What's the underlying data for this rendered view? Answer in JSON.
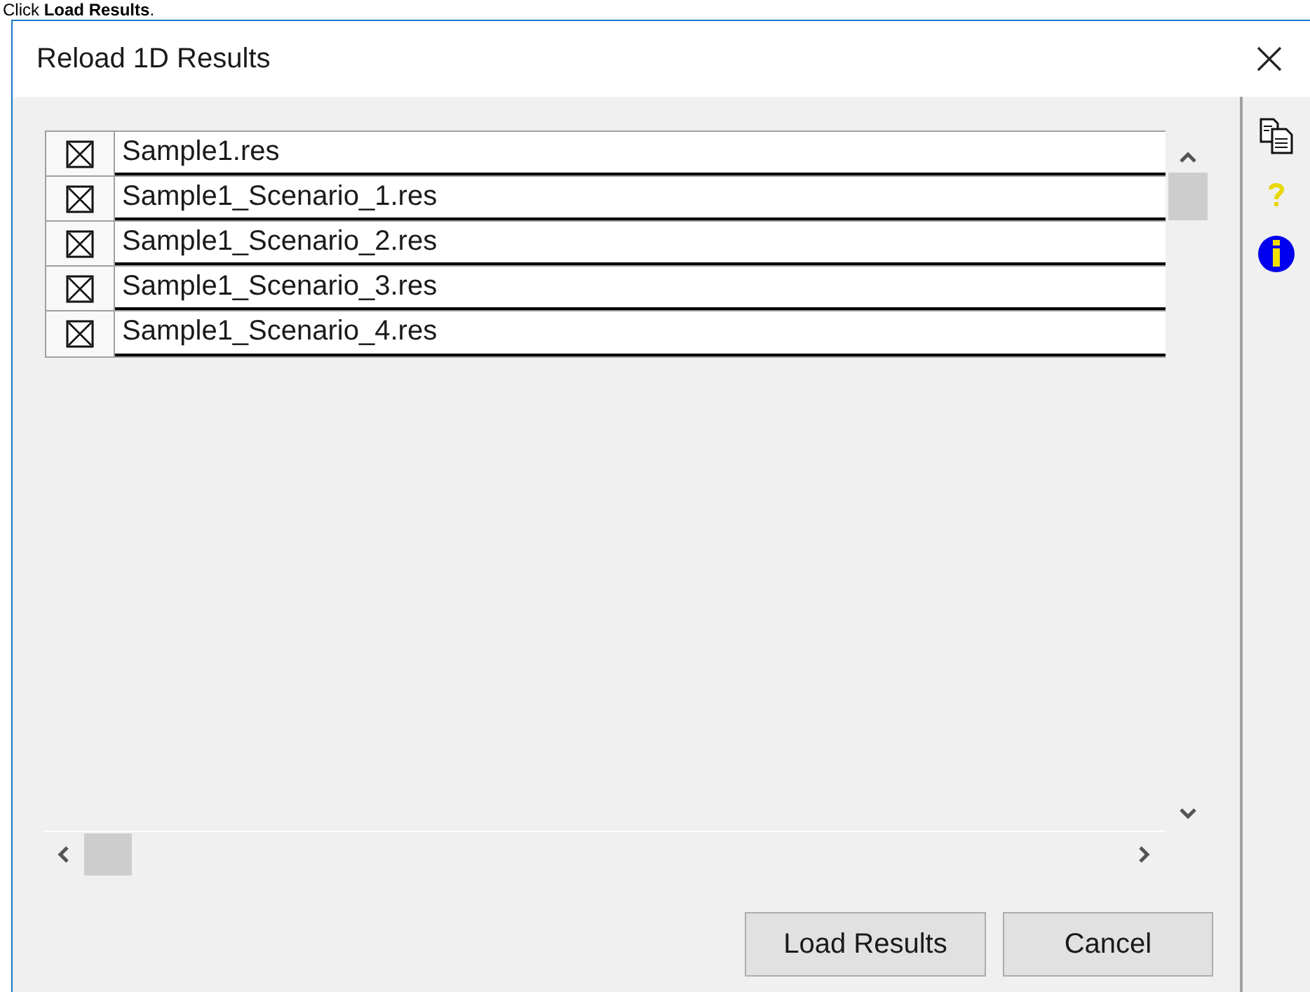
{
  "instruction": "Click **Load Results**.",
  "window": {
    "title": "Reload 1D Results"
  },
  "files": [
    {
      "name": "Sample1.res",
      "checked": true
    },
    {
      "name": "Sample1_Scenario_1.res",
      "checked": true
    },
    {
      "name": "Sample1_Scenario_2.res",
      "checked": true
    },
    {
      "name": "Sample1_Scenario_3.res",
      "checked": true
    },
    {
      "name": "Sample1_Scenario_4.res",
      "checked": true
    }
  ],
  "buttons": [
    {
      "label": "Load Results"
    },
    {
      "label": "Cancel"
    }
  ]
}
